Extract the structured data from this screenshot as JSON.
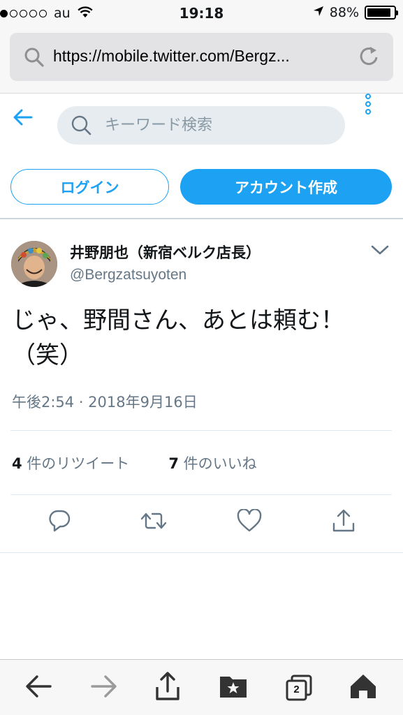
{
  "status_bar": {
    "carrier": "au",
    "time": "19:18",
    "battery": "88%",
    "battery_level": 0.88,
    "signal_bars": 1
  },
  "browser": {
    "url": "https://mobile.twitter.com/Bergz..."
  },
  "header": {
    "search_placeholder": "キーワード検索",
    "login_label": "ログイン",
    "signup_label": "アカウント作成"
  },
  "tweet": {
    "display_name": "井野朋也（新宿ベルク店長）",
    "handle": "@Bergzatsuyoten",
    "text_line1": "じゃ、野間さん、あとは頼む！",
    "text_line2": "（笑）",
    "timestamp": "午後2:54 · 2018年9月16日",
    "retweet_count": "4",
    "retweet_label": " 件のリツイート",
    "like_count": "7",
    "like_label": " 件のいいね"
  },
  "toolbar": {
    "tab_count": "2"
  },
  "colors": {
    "accent": "#1da1f2",
    "secondary_text": "#657786",
    "primary_text": "#14171a"
  }
}
